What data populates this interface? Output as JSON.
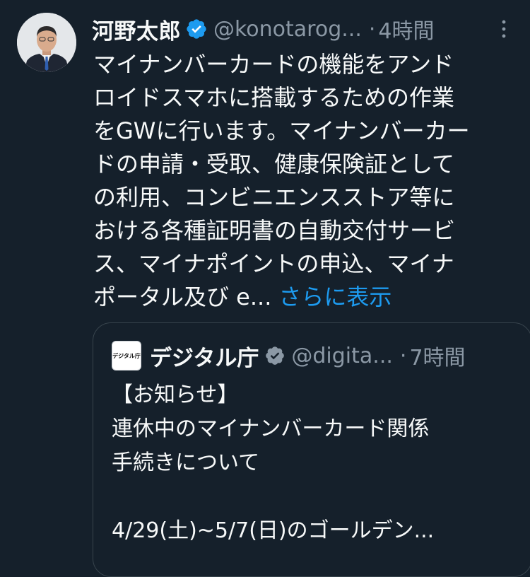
{
  "tweet": {
    "author_name": "河野太郎",
    "handle": "@konotarog...",
    "separator": "·",
    "time": "4時間",
    "text_lines": [
      "マイナンバーカードの機能をアンド",
      "ロイドスマホに搭載するための作業",
      "をGWに行います。マイナンバーカー",
      "ドの申請・受取、健康保険証として",
      "の利用、コンビニエンスストア等に",
      "おける各種証明書の自動交付サービ",
      "ス、マイナポイントの申込、マイナ",
      "ポータル及び e..."
    ],
    "show_more": "さらに表示"
  },
  "quote": {
    "logo_text": "デジタル庁",
    "author_name": "デジタル庁",
    "handle": "@digita...",
    "separator": "·",
    "time": "7時間",
    "text_lines": [
      "【お知らせ】",
      "連休中のマイナンバーカード関係",
      "手続きについて",
      "",
      "4/29(土)~5/7(日)のゴールデン..."
    ]
  },
  "colors": {
    "background": "#15202b",
    "text": "#f7f9f9",
    "secondary_text": "#8b98a5",
    "link": "#1d9bf0",
    "border": "#38444d",
    "verified_badge": "#1d9bf0",
    "quote_verified_badge": "#8b98a5"
  },
  "icons": {
    "verified": "verified-badge-icon",
    "more": "more-options-icon"
  }
}
